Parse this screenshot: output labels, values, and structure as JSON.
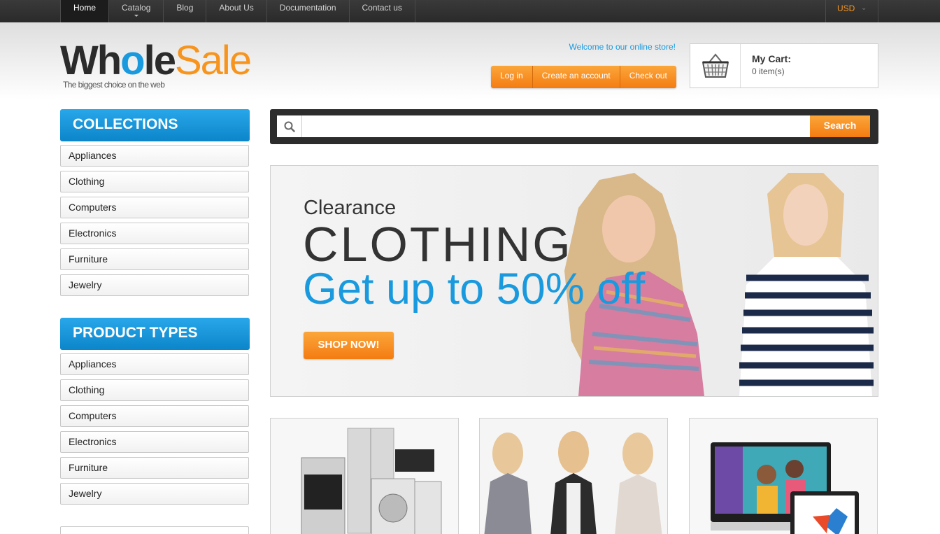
{
  "topnav": {
    "items": [
      {
        "label": "Home",
        "active": true
      },
      {
        "label": "Catalog",
        "has_dropdown": true
      },
      {
        "label": "Blog"
      },
      {
        "label": "About Us"
      },
      {
        "label": "Documentation"
      },
      {
        "label": "Contact us"
      }
    ],
    "currency": "USD"
  },
  "logo": {
    "part1": "Wh",
    "part2": "o",
    "part3": "le",
    "part4": "Sale",
    "tagline": "The biggest choice on the web"
  },
  "header": {
    "welcome": "Welcome to our online store!",
    "buttons": {
      "login": "Log in",
      "create_account": "Create an account",
      "checkout": "Check out"
    }
  },
  "cart": {
    "title": "My Cart:",
    "count": "0 item(s)"
  },
  "sidebar": {
    "collections": {
      "title": "COLLECTIONS",
      "items": [
        "Appliances",
        "Clothing",
        "Computers",
        "Electronics",
        "Furniture",
        "Jewelry"
      ]
    },
    "product_types": {
      "title": "PRODUCT TYPES",
      "items": [
        "Appliances",
        "Clothing",
        "Computers",
        "Electronics",
        "Furniture",
        "Jewelry"
      ]
    }
  },
  "search": {
    "placeholder": "",
    "button": "Search"
  },
  "banner": {
    "line1": "Clearance",
    "line2": "CLOTHING",
    "line3": "Get up to 50% off",
    "button": "SHOP NOW!"
  },
  "colors": {
    "accent_orange": "#f7941d",
    "accent_blue": "#1a9ade",
    "topbar": "#2a2a2a"
  }
}
